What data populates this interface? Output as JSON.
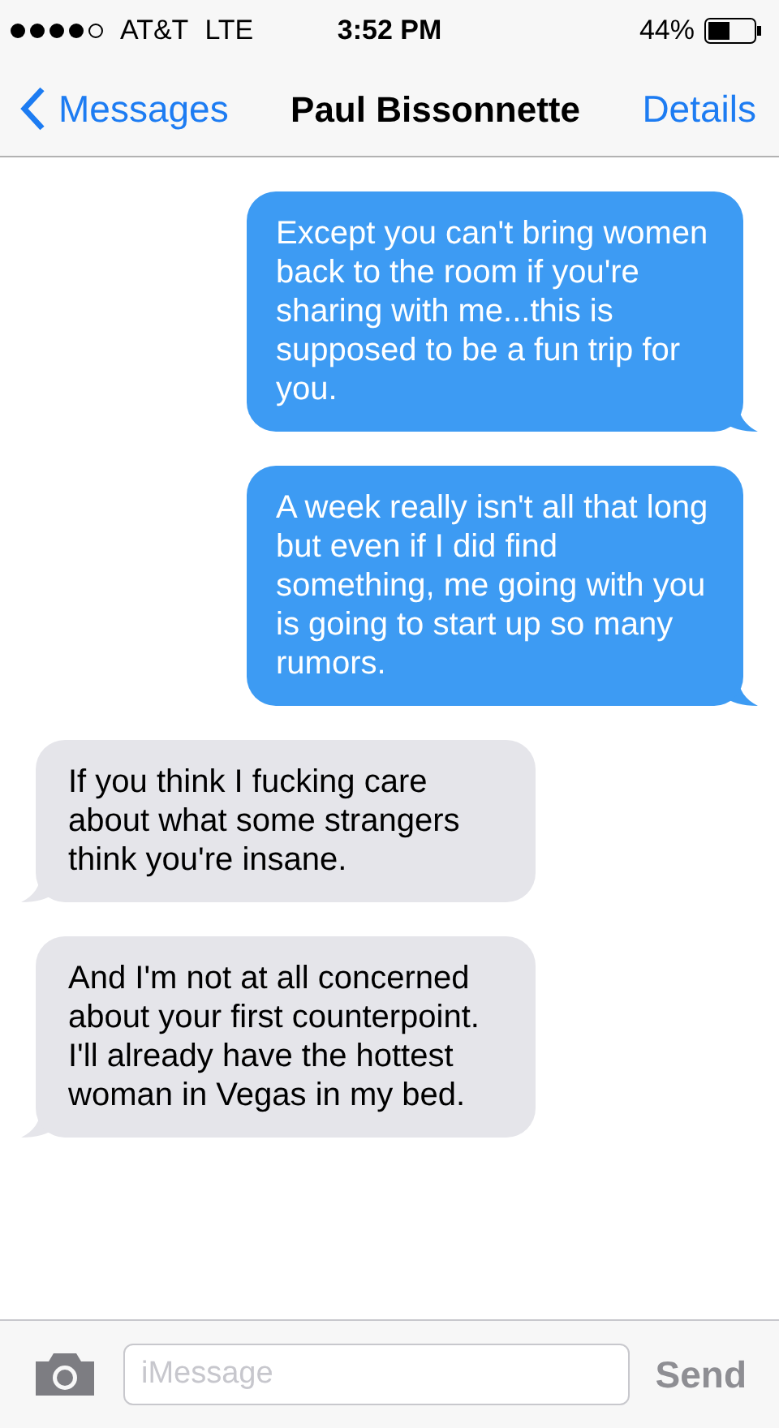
{
  "status_bar": {
    "carrier": "AT&T",
    "network": "LTE",
    "time": "3:52 PM",
    "battery": "44%"
  },
  "nav": {
    "back": "Messages",
    "title": "Paul Bissonnette",
    "action": "Details"
  },
  "messages": [
    {
      "kind": "sent",
      "text": "Except you can't bring women back to the room if you're sharing with me...this is supposed to be a fun trip for you."
    },
    {
      "kind": "sent",
      "text": "A week really isn't all that long but even if I did find something, me going with you is going to start up so many rumors."
    },
    {
      "kind": "received",
      "text": "If you think I fucking care about what some strangers think you're insane."
    },
    {
      "kind": "received",
      "text": "And I'm not at all concerned about your first counterpoint. I'll already have the hottest woman in Vegas in my bed."
    }
  ],
  "composer": {
    "placeholder": "iMessage",
    "send": "Send",
    "send_disabled": true
  }
}
